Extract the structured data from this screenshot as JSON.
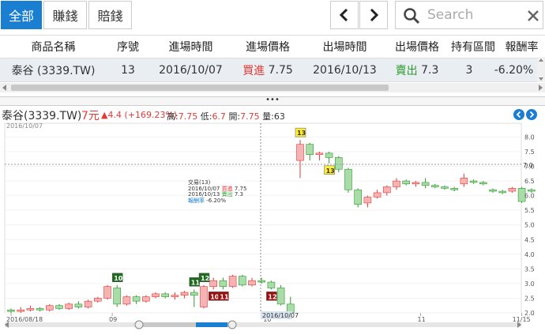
{
  "filters": [
    {
      "label": "全部",
      "active": true
    },
    {
      "label": "賺錢",
      "active": false
    },
    {
      "label": "賠錢",
      "active": false
    }
  ],
  "nav": {
    "prev_icon": "chevron-left-icon",
    "next_icon": "chevron-right-icon"
  },
  "search": {
    "placeholder": "Search",
    "icon": "search-icon",
    "clear_icon": "close-icon"
  },
  "table": {
    "headers": [
      "商品名稱",
      "序號",
      "進場時間",
      "進場價格",
      "出場時間",
      "出場價格",
      "持有區間",
      "報酬率"
    ],
    "row": {
      "name": "泰谷 (3339.TW)",
      "seq": "13",
      "entry_time": "2016/10/07",
      "entry_action": "買進",
      "entry_price": "7.75",
      "exit_time": "2016/10/13",
      "exit_action": "賣出",
      "exit_price": "7.3",
      "holding": "3",
      "return": "-6.20%"
    }
  },
  "splitter_label": "•••",
  "chart_header": {
    "name": "泰谷(3339.TW)",
    "price": "7元",
    "change": "▲4.4 (+169.23%)",
    "high_label": "高:",
    "high": "7.75",
    "low_label": "低:",
    "low": "6.7",
    "open_label": "開:",
    "open": "7.75",
    "vol_label": "量:",
    "vol": "63"
  },
  "colors": {
    "accent": "#1a7fd0",
    "up": "#e53935",
    "down": "#2e9a2e",
    "up_fill": "#f7b3b3",
    "down_fill": "#a9dca9"
  },
  "chart_data": {
    "type": "candlestick",
    "top_date_label": "2016/10/07",
    "crosshair_date": "2016/10/07",
    "crosshair_price": "7.0",
    "x_ticks": [
      "2016/08/18",
      "09",
      "10",
      "11",
      "11/15"
    ],
    "y_ticks": [
      "8.0",
      "7.5",
      "7.0",
      "6.5",
      "6.0",
      "5.5",
      "5.0",
      "4.5",
      "4.0",
      "3.5",
      "3.0",
      "2.5",
      "2.0"
    ],
    "ylim": [
      2.0,
      8.2
    ],
    "candles": [
      [
        2.1,
        2.15,
        2.05,
        2.0
      ],
      [
        2.05,
        2.2,
        2.1,
        2.0
      ],
      [
        2.1,
        2.25,
        2.15,
        2.05
      ],
      [
        2.15,
        2.2,
        2.1,
        2.05
      ],
      [
        2.1,
        2.3,
        2.25,
        2.05
      ],
      [
        2.25,
        2.3,
        2.15,
        2.1
      ],
      [
        2.15,
        2.35,
        2.3,
        2.1
      ],
      [
        2.3,
        2.4,
        2.2,
        2.15
      ],
      [
        2.2,
        2.45,
        2.4,
        2.15
      ],
      [
        2.4,
        2.55,
        2.5,
        2.35
      ],
      [
        2.5,
        2.95,
        2.9,
        2.45
      ],
      [
        2.85,
        2.95,
        2.3,
        2.2
      ],
      [
        2.3,
        2.6,
        2.55,
        2.25
      ],
      [
        2.55,
        2.6,
        2.4,
        2.3
      ],
      [
        2.4,
        2.6,
        2.55,
        2.35
      ],
      [
        2.55,
        2.7,
        2.65,
        2.5
      ],
      [
        2.65,
        2.7,
        2.55,
        2.5
      ],
      [
        2.55,
        2.7,
        2.6,
        2.45
      ],
      [
        2.6,
        2.75,
        2.7,
        2.5
      ],
      [
        2.7,
        2.8,
        2.6,
        2.2
      ],
      [
        2.2,
        2.95,
        2.9,
        2.15
      ],
      [
        2.9,
        3.2,
        3.1,
        2.8
      ],
      [
        3.1,
        3.2,
        2.9,
        2.8
      ],
      [
        2.9,
        3.3,
        3.25,
        2.85
      ],
      [
        3.25,
        3.3,
        2.95,
        2.9
      ],
      [
        2.95,
        3.2,
        3.1,
        2.9
      ],
      [
        3.1,
        3.2,
        3.05,
        3.0
      ],
      [
        3.05,
        3.1,
        2.85,
        2.8
      ],
      [
        2.85,
        2.95,
        2.3,
        2.25
      ],
      [
        2.3,
        2.55,
        2.0,
        1.95
      ],
      [
        7.2,
        7.9,
        7.75,
        6.6
      ],
      [
        7.75,
        7.8,
        7.4,
        7.2
      ],
      [
        7.4,
        7.5,
        7.45,
        7.2
      ],
      [
        7.45,
        7.5,
        7.3,
        7.1
      ],
      [
        7.3,
        7.35,
        6.9,
        6.8
      ],
      [
        6.9,
        6.95,
        6.2,
        6.1
      ],
      [
        6.2,
        6.25,
        5.7,
        5.6
      ],
      [
        5.75,
        6.0,
        5.95,
        5.6
      ],
      [
        5.95,
        6.2,
        6.1,
        5.9
      ],
      [
        6.1,
        6.35,
        6.3,
        6.0
      ],
      [
        6.3,
        6.6,
        6.5,
        6.2
      ],
      [
        6.5,
        6.55,
        6.4,
        6.35
      ],
      [
        6.4,
        6.5,
        6.45,
        6.3
      ],
      [
        6.45,
        6.6,
        6.35,
        6.25
      ],
      [
        6.35,
        6.4,
        6.3,
        6.25
      ],
      [
        6.3,
        6.35,
        6.25,
        6.2
      ],
      [
        6.25,
        6.3,
        6.2,
        6.15
      ],
      [
        6.4,
        6.75,
        6.6,
        6.3
      ],
      [
        6.5,
        6.55,
        6.45,
        6.4
      ],
      [
        6.45,
        6.5,
        6.4,
        6.35
      ],
      [
        6.2,
        6.25,
        6.15,
        6.1
      ],
      [
        6.15,
        6.2,
        6.1,
        6.05
      ],
      [
        6.15,
        6.3,
        6.25,
        6.1
      ],
      [
        6.25,
        6.3,
        5.8,
        5.75
      ],
      [
        6.2,
        6.25,
        6.15,
        6.1
      ]
    ],
    "markers": [
      {
        "label": "10",
        "index": 11,
        "side": "buy"
      },
      {
        "label": "11",
        "index": 19,
        "side": "buy"
      },
      {
        "label": "12",
        "index": 20,
        "side": "buy"
      },
      {
        "label": "10",
        "index": 21,
        "side": "sell"
      },
      {
        "label": "11",
        "index": 22,
        "side": "sell"
      },
      {
        "label": "12",
        "index": 27,
        "side": "sell"
      },
      {
        "label": "13",
        "index": 30,
        "side": "buy"
      },
      {
        "label": "13",
        "index": 33,
        "side": "sell"
      }
    ],
    "tooltip": {
      "title": "交易(13)",
      "line1_date": "2016/10/07",
      "line1_action": "買進",
      "line1_price": "7.75",
      "line2_date": "2016/10/13",
      "line2_action": "賣出",
      "line2_price": "7.3",
      "line3_label": "報酬率",
      "line3_value": "-6.20%"
    }
  }
}
